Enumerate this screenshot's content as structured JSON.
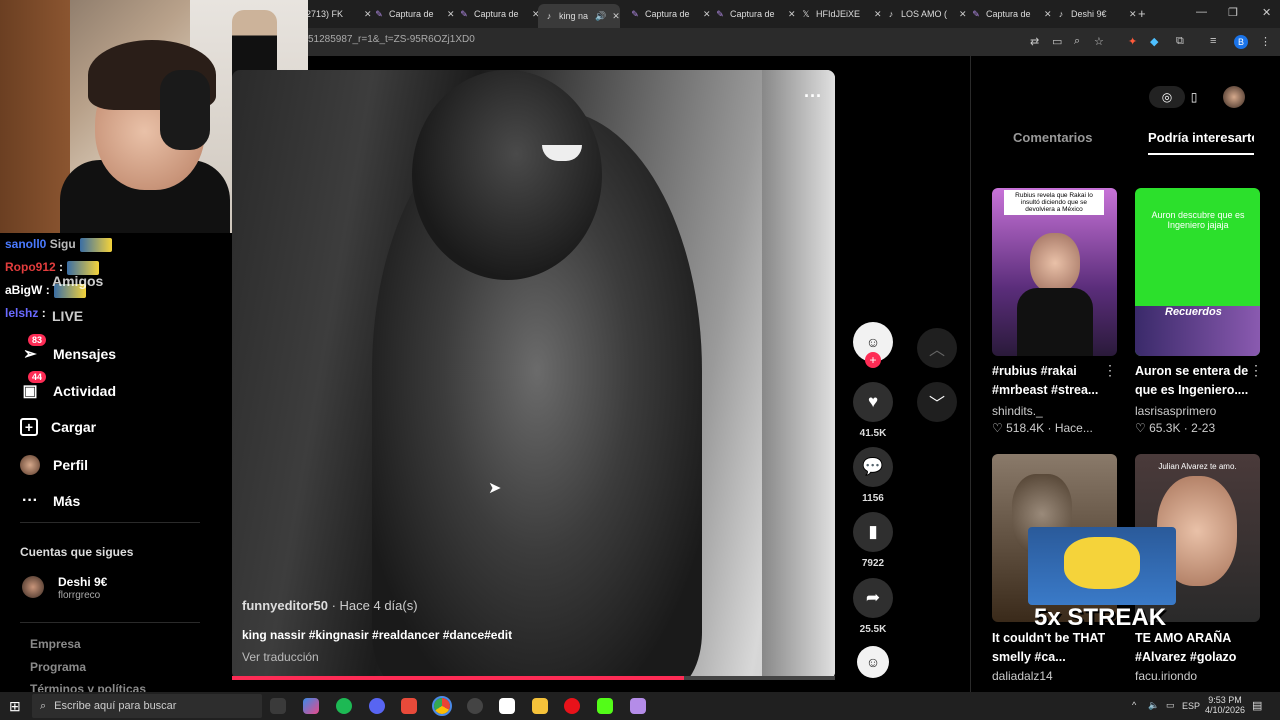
{
  "browser": {
    "tabs": [
      {
        "label": "2713) FK",
        "icon": "generic-tab-icon"
      },
      {
        "label": "Captura de",
        "icon": "feather-icon"
      },
      {
        "label": "Captura de",
        "icon": "feather-icon"
      },
      {
        "label": "king na",
        "icon": "tiktok-icon",
        "active": true
      },
      {
        "label": "Captura de",
        "icon": "feather-icon"
      },
      {
        "label": "Captura de",
        "icon": "feather-icon"
      },
      {
        "label": "HFIdJEiXE",
        "icon": "x-icon"
      },
      {
        "label": "LOS AMO (",
        "icon": "tiktok-icon"
      },
      {
        "label": "Captura de",
        "icon": "feather-icon"
      },
      {
        "label": "Deshi 9€",
        "icon": "tiktok-icon"
      }
    ],
    "url": "51285987_r=1&_t=ZS-95R6OZj1XD0",
    "profile_initial": "B"
  },
  "chat": [
    {
      "user": "sanoll0",
      "color": "#4a7aff",
      "text": "Sigu"
    },
    {
      "user": "Ropo912",
      "color": "#e23d3d",
      "text": ":"
    },
    {
      "user": "aBigW",
      "color": "#ffffff",
      "text": ":"
    },
    {
      "user": "lelshz",
      "color": "#6a6aff",
      "text": ":"
    }
  ],
  "nav": {
    "amigos": "Amigos",
    "live": "LIVE",
    "mensajes": "Mensajes",
    "mensajes_badge": "83",
    "actividad": "Actividad",
    "actividad_badge": "44",
    "cargar": "Cargar",
    "perfil": "Perfil",
    "mas": "Más"
  },
  "following": {
    "heading": "Cuentas que sigues",
    "name": "Deshi 9€",
    "handle": "florrgreco"
  },
  "footer": {
    "empresa": "Empresa",
    "programa": "Programa",
    "terminos": "Términos y políticas"
  },
  "video": {
    "author": "funnyeditor50",
    "time": " · Hace 4 día(s)",
    "caption": "king nassir #kingnasir #realdancer #dance#edit",
    "translate": "Ver traducción",
    "progress": 0.75
  },
  "actions": {
    "likes": "41.5K",
    "comments": "1156",
    "saves": "7922",
    "shares": "25.5K"
  },
  "right_panel": {
    "tab_comments": "Comentarios",
    "tab_suggest": "Podría interesarte",
    "cards": [
      {
        "caption": "#rubius #rakai #mrbeast #strea...",
        "author": "shindits._",
        "likes": "518.4K",
        "date": "Hace...",
        "thumb_text": "Rubius revela que Rakai lo insultó diciendo que se devolviera a México"
      },
      {
        "caption": "Auron se entera de que es Ingeniero....",
        "author": "lasrisasprimero",
        "likes": "65.3K",
        "date": "2-23",
        "thumb_text": "Auron descubre que es Ingeniero jajaja",
        "thumb_sub": "Recuerdos"
      },
      {
        "caption": "It couldn't be THAT smelly #ca...",
        "author": "daliadalz14",
        "thumb_text": ""
      },
      {
        "caption": "TE AMO ARAÑA #Alvarez #golazo",
        "author": "facu.iriondo",
        "thumb_text": "Julian Alvarez te amo."
      }
    ],
    "streak": "5x STREAK"
  },
  "taskbar": {
    "search_placeholder": "Escribe aquí para buscar",
    "lang": "ESP",
    "time": "9:53 PM",
    "date": "4/10/2026"
  }
}
